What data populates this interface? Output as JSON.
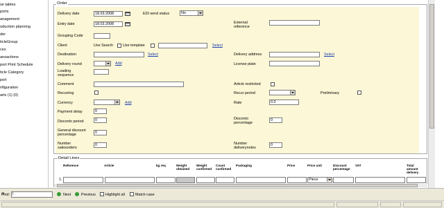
{
  "sidebar": {
    "items": [
      "se tables",
      "ports",
      "anagement",
      "oduction planning",
      "der",
      "ticleGroup",
      "ces",
      "ansactions",
      "port Print Schedule",
      "ticle Category",
      "port",
      "nfiguration",
      "arts (1) (0)"
    ]
  },
  "order": {
    "legend": "Order",
    "delivery_date_label": "Delivery date",
    "delivery_date_value": "18.03.2008",
    "edi_label": "EDI send status",
    "edi_value": "No",
    "entry_date_label": "Entry date",
    "entry_date_value": "18.03.2008",
    "external_reference_label": "External reference",
    "grouping_code_label": "Grouping Code",
    "client_label": "Client",
    "use_search_label": "Use Search",
    "use_template_label": "Use template",
    "select_label": "Select",
    "destination_label": "Destination",
    "delivery_address_label": "Delivery address",
    "delivery_round_label": "Delivery round",
    "add_label": "Add",
    "license_plate_label": "License plate",
    "loading_sequence_label": "Loading sequence",
    "comment_label": "Comment",
    "article_restricted_label": "Article restricted",
    "recurring_label": "Recurring",
    "recur_period_label": "Recur period",
    "preliminary_label": "Preliminary",
    "currency_label": "Currency",
    "rate_label": "Rate",
    "rate_value": "0.0",
    "payment_delay_label": "Payment delay",
    "payment_delay_value": "0",
    "disconto_period_label": "Disconto period",
    "disconto_period_value": "0",
    "disconto_percentage_label": "Disconto percentage",
    "disconto_percentage_value": "0",
    "general_discount_label": "General discount percentage",
    "general_discount_value": "0",
    "number_salesorders_label": "Number salesorders",
    "number_salesorders_value": "0",
    "number_deliverynotes_label": "Number deliverynotes",
    "number_deliverynotes_value": "0"
  },
  "detail_lines": {
    "legend": "Detail Lines",
    "headers": [
      "Reference",
      "Article",
      "kg req",
      "Weight obtained",
      "Weight confirmed",
      "Count confirmed",
      "Packaging",
      "Price",
      "Price unit",
      "Discount percentage",
      "VAT",
      "Total amount delivery"
    ],
    "row_number": "1.",
    "price_unit_value": "Piece"
  },
  "findbar": {
    "find_label": "Find:",
    "find_value": "l",
    "next_label": "Next",
    "previous_label": "Previous",
    "highlight_all_label": "Highlight all",
    "match_case_label": "Match case"
  },
  "colors": {
    "panel_bg": "#fcf7d6",
    "link": "#1a3fb0",
    "chrome": "#ece9d8"
  }
}
